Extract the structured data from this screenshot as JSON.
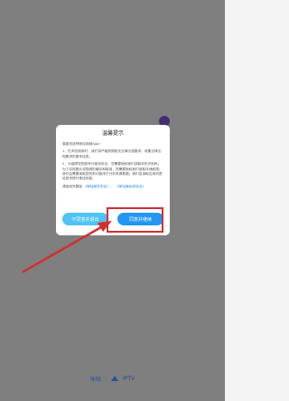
{
  "dialog": {
    "title": "温馨提示",
    "intro": "感谢您选择咪咕视频App!",
    "para1": "1、在浏览使用时，我们将严格按照相关法律法规要求，收集法律法规要求的基本信息。",
    "para2": "2、为保障您的账号与使用安全，您需要授权我们读取本机识别码；为了实现图片或视频的缓存和取用，您需要授权我们读取存储权限；我们会需要读取您的剪切板用于分析来源数据；我们会读取应用列表信息来提升推送效能。",
    "para3_prefix": "请查阅完整版",
    "link_service": "《咪咕服务协议》",
    "conjunction": "、",
    "link_privacy": "《咪咕隐私权协议》",
    "btn_decline": "不同意并退出",
    "btn_accept": "同意并继续"
  },
  "footer": {
    "brand1": "咪咕",
    "brand2": "IPTV"
  },
  "colors": {
    "accent": "#2196f3",
    "decline": "#4fc3f7",
    "highlight": "#d32f2f",
    "link": "#1e88e5"
  }
}
